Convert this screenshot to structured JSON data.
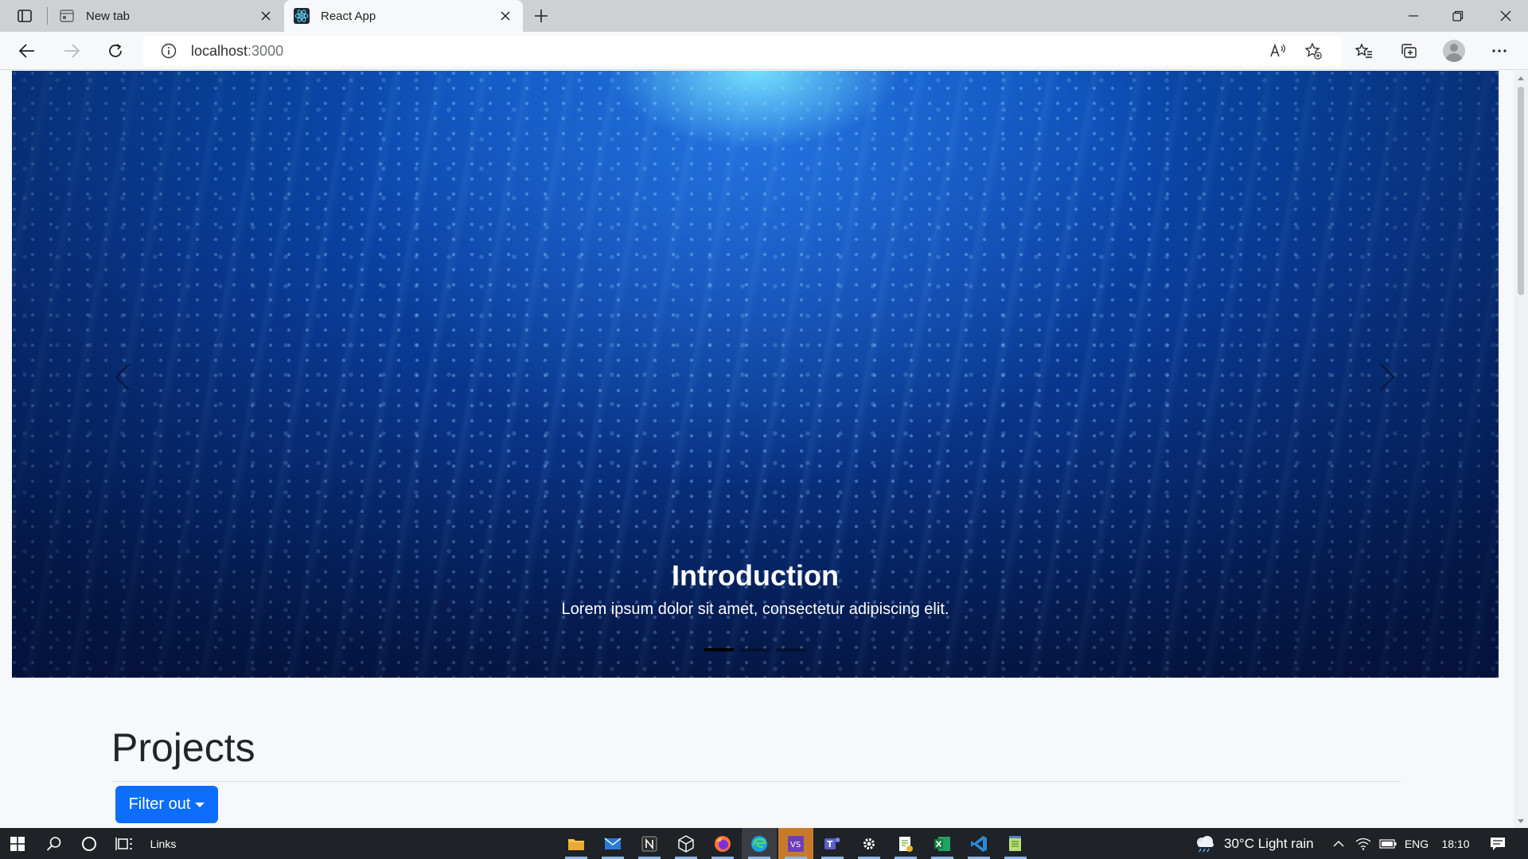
{
  "browser": {
    "tabs": [
      {
        "title": "New tab",
        "active": false
      },
      {
        "title": "React App",
        "active": true
      }
    ],
    "url_host": "localhost",
    "url_port": ":3000"
  },
  "carousel": {
    "slides_count": 3,
    "active_index": 0,
    "caption_title": "Introduction",
    "caption_text": "Lorem ipsum dolor sit amet, consectetur adipiscing elit."
  },
  "projects": {
    "heading": "Projects",
    "filter_button_label": "Filter out"
  },
  "taskbar": {
    "links_label": "Links",
    "weather_text": "30°C  Light rain",
    "language": "ENG",
    "time": "18:10",
    "apps": [
      "file-explorer",
      "mail",
      "notion",
      "3d-viewer",
      "firefox",
      "edge",
      "visual-studio",
      "teams",
      "settings",
      "notepad-plus",
      "excel",
      "vscode",
      "notepad"
    ]
  },
  "colors": {
    "primary_button": "#0d6efd",
    "taskbar": "#1f2226",
    "titlebar": "#cfd0d1"
  }
}
